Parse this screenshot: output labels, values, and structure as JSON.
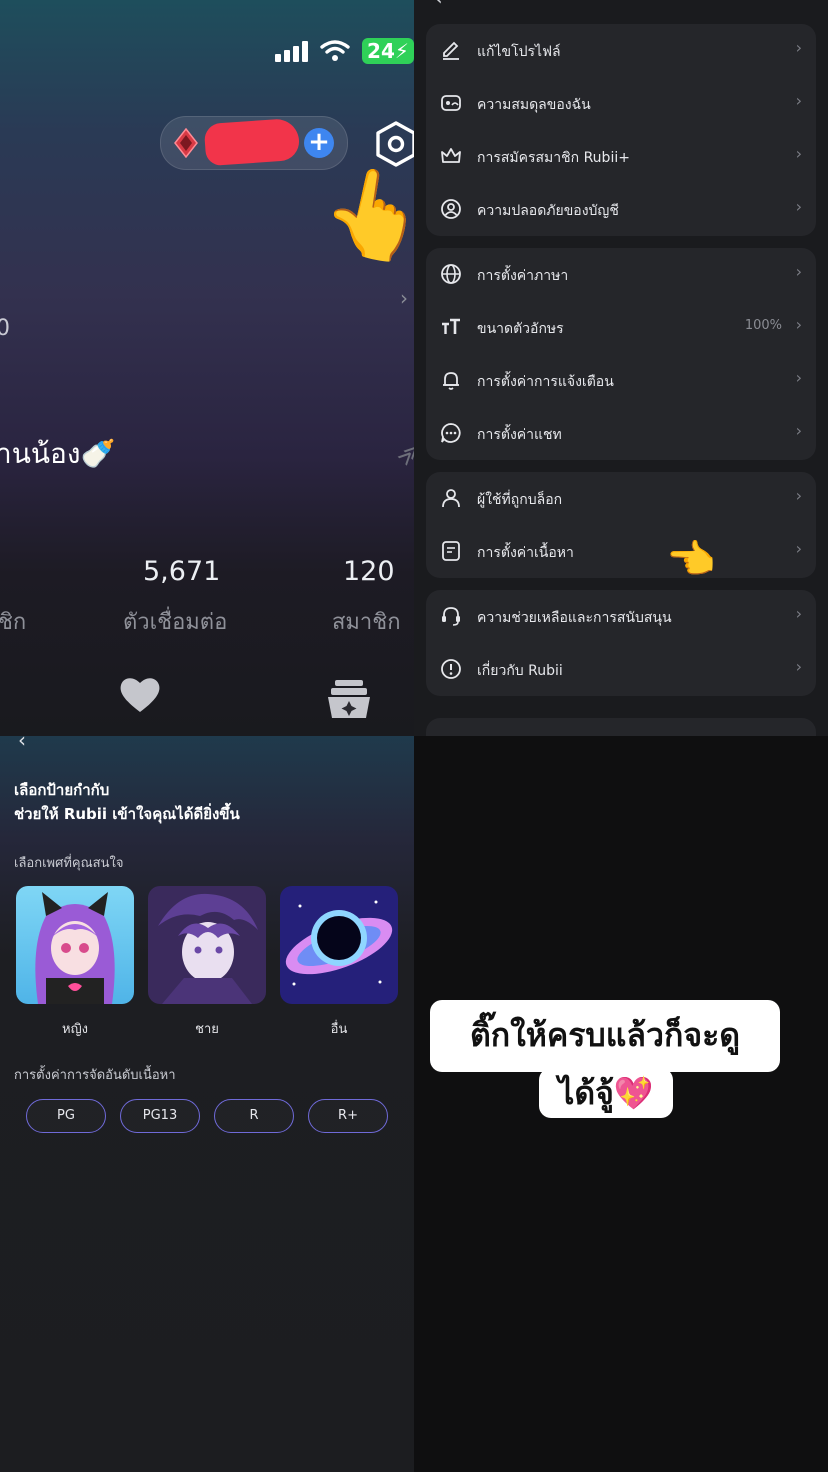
{
  "profile": {
    "status_battery": "24",
    "nickname_partial": "านน้อง🍼",
    "stats": [
      {
        "value": "5,671",
        "label": "ตัวเชื่อมต่อ"
      },
      {
        "value": "120",
        "label": "สมาชิก"
      }
    ],
    "stat_cut_label": "ชิก",
    "left_cut": "0"
  },
  "settings": {
    "groups": [
      [
        {
          "label": "แก้ไขโปรไฟล์",
          "icon": "edit-icon"
        },
        {
          "label": "ความสมดุลของฉัน",
          "icon": "wallet-icon"
        },
        {
          "label": "การสมัครสมาชิก Rubii+",
          "icon": "crown-icon"
        },
        {
          "label": "ความปลอดภัยของบัญชี",
          "icon": "account-icon"
        }
      ],
      [
        {
          "label": "การตั้งค่าภาษา",
          "icon": "globe-icon"
        },
        {
          "label": "ขนาดตัวอักษร",
          "icon": "text-size-icon",
          "value": "100%"
        },
        {
          "label": "การตั้งค่าการแจ้งเตือน",
          "icon": "bell-icon"
        },
        {
          "label": "การตั้งค่าแชท",
          "icon": "chat-icon"
        }
      ],
      [
        {
          "label": "ผู้ใช้ที่ถูกบล็อก",
          "icon": "user-icon"
        },
        {
          "label": "การตั้งค่าเนื้อหา",
          "icon": "content-icon"
        }
      ],
      [
        {
          "label": "ความช่วยเหลือและการสนับสนุน",
          "icon": "headset-icon"
        },
        {
          "label": "เกี่ยวกับ Rubii",
          "icon": "info-icon"
        }
      ]
    ]
  },
  "tags": {
    "heading_line1": "เลือกป้ายกำกับ",
    "heading_line2": "ช่วยให้ Rubii เข้าใจคุณได้ดียิ่งขึ้น",
    "gender_section": "เลือกเพศที่คุณสนใจ",
    "genders": [
      "หญิง",
      "ชาย",
      "อื่น"
    ],
    "rating_section": "การตั้งค่าการจัดอันดับเนื้อหา",
    "ratings": [
      "PG",
      "PG13",
      "R",
      "R+"
    ]
  },
  "caption": {
    "line1": "ติ๊กให้ครบแล้วก็จะดู",
    "line2": "ได้จู้💖"
  },
  "colors": {
    "accent_blue": "#3e86f0",
    "scribble_red": "#f2344a",
    "battery_green": "#2fd158",
    "rating_border": "#6f6ad8"
  }
}
